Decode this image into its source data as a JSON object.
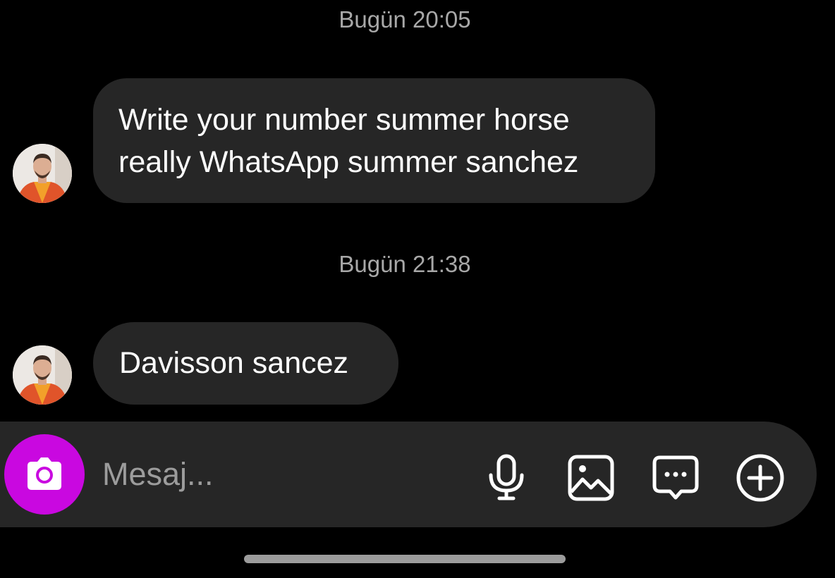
{
  "conversation": {
    "groups": [
      {
        "timestamp": "Bugün 20:05",
        "message_lines": [
          "Write your number summer horse",
          "really WhatsApp summer sanchez"
        ]
      },
      {
        "timestamp": "Bugün 21:38",
        "message_lines": [
          "Davisson sancez"
        ]
      }
    ]
  },
  "composer": {
    "placeholder": "Mesaj...",
    "value": "",
    "camera_icon": "camera-icon",
    "tools": [
      "microphone-icon",
      "image-gallery-icon",
      "sticker-chat-icon",
      "plus-circle-icon"
    ]
  },
  "colors": {
    "background": "#000000",
    "bubble": "#262626",
    "composer": "#262626",
    "camera_button": "#c908e0",
    "timestamp_text": "#a8a8a8",
    "placeholder_text": "#9c9c9c"
  }
}
